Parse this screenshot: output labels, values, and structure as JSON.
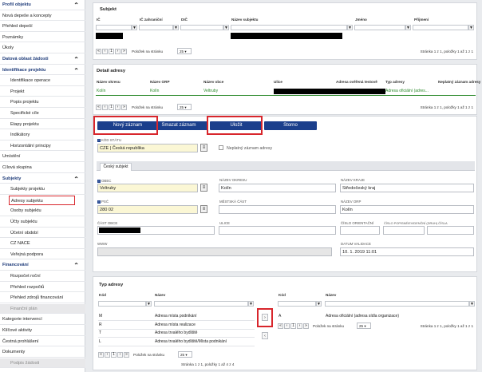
{
  "sidebar": {
    "items": [
      {
        "label": "Profil objektu",
        "type": "sec",
        "chev": "^"
      },
      {
        "label": "Nová depeše a koncepty",
        "type": "top"
      },
      {
        "label": "Přehled depeší",
        "type": "top"
      },
      {
        "label": "Poznámky",
        "type": "top"
      },
      {
        "label": "Úkoly",
        "type": "top"
      },
      {
        "label": "Datová oblast žádosti",
        "type": "sec",
        "chev": "^"
      },
      {
        "label": "Identifikace projektu",
        "type": "sec",
        "chev": "^"
      },
      {
        "label": "Identifikace operace",
        "type": "sub"
      },
      {
        "label": "Projekt",
        "type": "sub"
      },
      {
        "label": "Popis projektu",
        "type": "sub"
      },
      {
        "label": "Specifické cíle",
        "type": "sub"
      },
      {
        "label": "Etapy projektu",
        "type": "sub"
      },
      {
        "label": "Indikátory",
        "type": "sub"
      },
      {
        "label": "Horizontální principy",
        "type": "sub"
      },
      {
        "label": "Umístění",
        "type": "top"
      },
      {
        "label": "Cílová skupina",
        "type": "top"
      },
      {
        "label": "Subjekty",
        "type": "sec",
        "chev": "^"
      },
      {
        "label": "Subjekty projektu",
        "type": "sub"
      },
      {
        "label": "Adresy subjektu",
        "type": "sel"
      },
      {
        "label": "Osoby subjektu",
        "type": "sub"
      },
      {
        "label": "Účty subjektu",
        "type": "sub"
      },
      {
        "label": "Účetní období",
        "type": "sub"
      },
      {
        "label": "CZ NACE",
        "type": "sub"
      },
      {
        "label": "Veřejná podpora",
        "type": "sub"
      },
      {
        "label": "Financování",
        "type": "sec",
        "chev": "^"
      },
      {
        "label": "Rozpočet roční",
        "type": "sub"
      },
      {
        "label": "Přehled rozpočtů",
        "type": "sub"
      },
      {
        "label": "Přehled zdrojů financování",
        "type": "sub"
      },
      {
        "label": "Finanční plán",
        "type": "dis"
      },
      {
        "label": "Kategorie intervencí",
        "type": "top"
      },
      {
        "label": "Klíčové aktivity",
        "type": "top"
      },
      {
        "label": "Čestná prohlášení",
        "type": "top"
      },
      {
        "label": "Dokumenty",
        "type": "top"
      },
      {
        "label": "Podpis žádosti",
        "type": "dis"
      }
    ]
  },
  "subjekt_table": {
    "title": "Subjekt",
    "columns": [
      "IČ",
      "IČ zahraniční",
      "DIČ",
      "Název subjektu",
      "Jméno",
      "Příjmení"
    ],
    "per_page_label": "Položek na stránku",
    "per_page": "25",
    "page": "1",
    "paging": "Stránka 1 z 1, položky 1 až 1 z 1"
  },
  "detail_table": {
    "title": "Detail adresy",
    "columns": [
      "Název okresu",
      "Název ORP",
      "Název obce",
      "Ulice",
      "Adresa ověřená testově",
      "Typ adresy",
      "Neplatný záznam adresy"
    ],
    "row": {
      "okres": "Kolín",
      "orp": "Kolín",
      "obec": "Veltruby",
      "typ": "Adresa oficiální (adres..."
    },
    "per_page_label": "Položek na stránku",
    "per_page": "25",
    "page": "1",
    "paging": "Stránka 1 z 1, položky 1 až 1 z 1"
  },
  "buttons": {
    "new": "Nový záznam",
    "delete": "Smazat záznam",
    "save": "Uložit",
    "cancel": "Storno"
  },
  "form": {
    "kod_statu_label": "KÓD STÁTU",
    "kod_statu": "CZE | Česká republika",
    "neplatny_label": "Neplatný záznam adresy",
    "tab": "Český subjekt",
    "obec_label": "OBEC",
    "obec": "Veltruby",
    "nazev_okresu_label": "NÁZEV OKRESU",
    "nazev_okresu": "Kolín",
    "nazev_kraje_label": "NÁZEV KRAJE",
    "nazev_kraje": "Středočeský kraj",
    "psc_label": "PSČ",
    "psc": "280 02",
    "mestska_cast_label": "MĚSTSKÁ ČÁST",
    "nazev_orp_label": "NÁZEV ORP",
    "nazev_orp": "Kolín",
    "cast_obce_label": "ČÁST OBCE",
    "ulice_label": "ULICE",
    "cislo_orientacni_label": "ČÍSLO ORIENTAČNÍ",
    "cislo_popisne_label": "ČÍSLO POPISNÉ/EVIDENČNÍ (DRUH) ČÍSLA",
    "www_label": "WWW",
    "datum_label": "DATUM VALIDACE",
    "datum": "10. 1. 2019 11:01"
  },
  "typ_adresy": {
    "title": "Typ adresy",
    "columns": [
      "Kód",
      "Název"
    ],
    "rows": [
      {
        "kod": "M",
        "nazev": "Adresa místa podnikání"
      },
      {
        "kod": "R",
        "nazev": "Adresa místa realizace"
      },
      {
        "kod": "T",
        "nazev": "Adresa trvalého bydliště"
      },
      {
        "kod": "L",
        "nazev": "Adresa trvalého bydliště/Místa podnikání"
      }
    ],
    "per_page_label": "Položek na stránku",
    "per_page": "25",
    "page": "1",
    "paging": "Stránka 1 z 1, položky 1 až 4 z 4"
  },
  "selected_typ": {
    "columns": [
      "Kód",
      "Název"
    ],
    "rows": [
      {
        "kod": "A",
        "nazev": "Adresa oficiální (adresa sídla organizace)"
      }
    ],
    "per_page_label": "Položek na stránku",
    "per_page": "25",
    "page": "1",
    "paging": "Stránka 1 z 1, položky 1 až 1 z 1"
  },
  "colors": {
    "accent": "#1b3f8c",
    "highlight": "#d8262c",
    "required_bg": "#fbf7d5"
  }
}
